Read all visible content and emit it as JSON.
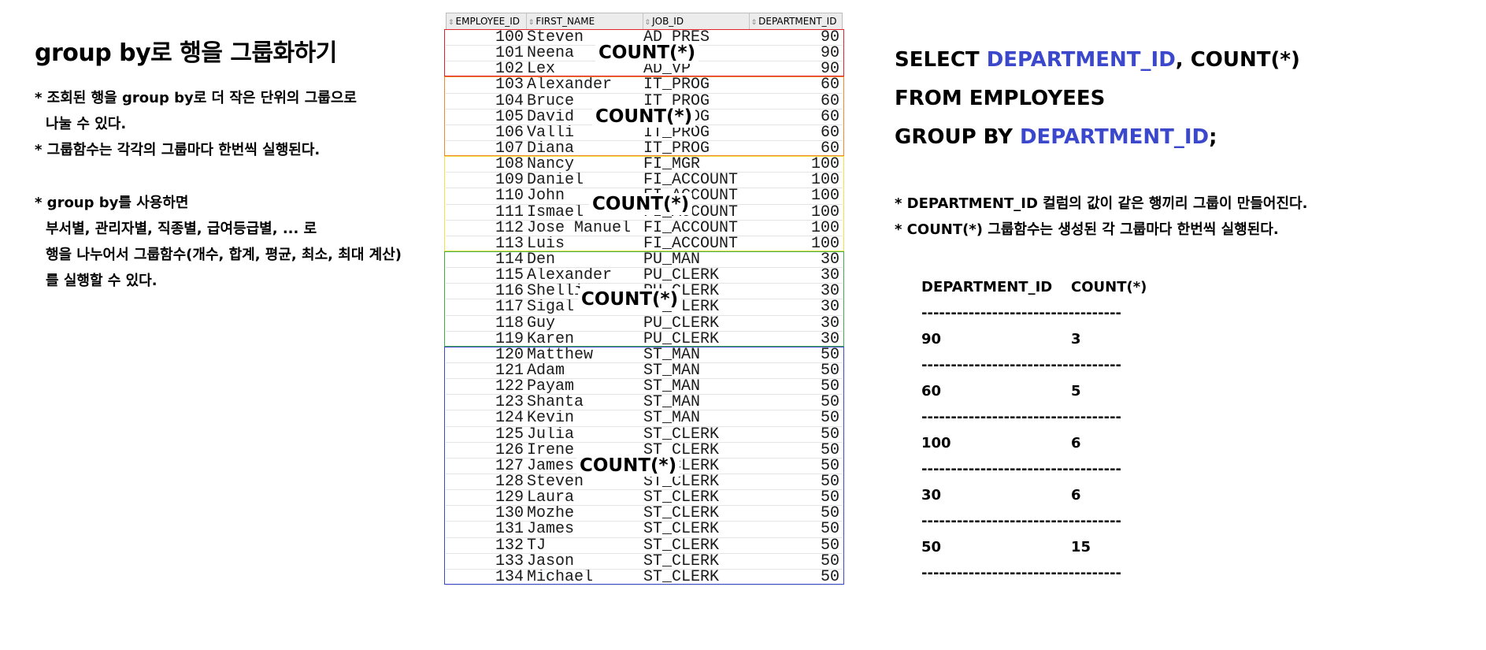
{
  "left": {
    "title": "group by로 행을 그룹화하기",
    "lines1": [
      "* 조회된 행을 group by로 더 작은 단위의 그룹으로",
      "  나눌 수 있다.",
      "* 그룹함수는 각각의 그룹마다 한번씩 실행된다."
    ],
    "lines2": [
      "* group by를 사용하면",
      "  부서별, 관리자별, 직종별, 급여등급별, ... 로",
      "  행을 나누어서 그룹함수(개수, 합계, 평균, 최소, 최대 계산)",
      "  를 실행할 수 있다."
    ]
  },
  "grid": {
    "columns": [
      "EMPLOYEE_ID",
      "FIRST_NAME",
      "JOB_ID",
      "DEPARTMENT_ID"
    ],
    "rows": [
      [
        "100",
        "Steven",
        "AD_PRES",
        "90"
      ],
      [
        "101",
        "Neena",
        "AD_VP",
        "90"
      ],
      [
        "102",
        "Lex",
        "AD_VP",
        "90"
      ],
      [
        "103",
        "Alexander",
        "IT_PROG",
        "60"
      ],
      [
        "104",
        "Bruce",
        "IT_PROG",
        "60"
      ],
      [
        "105",
        "David",
        "IT_PROG",
        "60"
      ],
      [
        "106",
        "Valli",
        "IT_PROG",
        "60"
      ],
      [
        "107",
        "Diana",
        "IT_PROG",
        "60"
      ],
      [
        "108",
        "Nancy",
        "FI_MGR",
        "100"
      ],
      [
        "109",
        "Daniel",
        "FI_ACCOUNT",
        "100"
      ],
      [
        "110",
        "John",
        "FI_ACCOUNT",
        "100"
      ],
      [
        "111",
        "Ismael",
        "FI_ACCOUNT",
        "100"
      ],
      [
        "112",
        "Jose Manuel",
        "FI_ACCOUNT",
        "100"
      ],
      [
        "113",
        "Luis",
        "FI_ACCOUNT",
        "100"
      ],
      [
        "114",
        "Den",
        "PU_MAN",
        "30"
      ],
      [
        "115",
        "Alexander",
        "PU_CLERK",
        "30"
      ],
      [
        "116",
        "Shelli",
        "PU_CLERK",
        "30"
      ],
      [
        "117",
        "Sigal",
        "PU_CLERK",
        "30"
      ],
      [
        "118",
        "Guy",
        "PU_CLERK",
        "30"
      ],
      [
        "119",
        "Karen",
        "PU_CLERK",
        "30"
      ],
      [
        "120",
        "Matthew",
        "ST_MAN",
        "50"
      ],
      [
        "121",
        "Adam",
        "ST_MAN",
        "50"
      ],
      [
        "122",
        "Payam",
        "ST_MAN",
        "50"
      ],
      [
        "123",
        "Shanta",
        "ST_MAN",
        "50"
      ],
      [
        "124",
        "Kevin",
        "ST_MAN",
        "50"
      ],
      [
        "125",
        "Julia",
        "ST_CLERK",
        "50"
      ],
      [
        "126",
        "Irene",
        "ST_CLERK",
        "50"
      ],
      [
        "127",
        "James",
        "ST_CLERK",
        "50"
      ],
      [
        "128",
        "Steven",
        "ST_CLERK",
        "50"
      ],
      [
        "129",
        "Laura",
        "ST_CLERK",
        "50"
      ],
      [
        "130",
        "Mozhe",
        "ST_CLERK",
        "50"
      ],
      [
        "131",
        "James",
        "ST_CLERK",
        "50"
      ],
      [
        "132",
        "TJ",
        "ST_CLERK",
        "50"
      ],
      [
        "133",
        "Jason",
        "ST_CLERK",
        "50"
      ],
      [
        "134",
        "Michael",
        "ST_CLERK",
        "50"
      ]
    ],
    "groups": [
      {
        "label": "COUNT(*)",
        "color": "#e0242c",
        "start": 0,
        "count": 3
      },
      {
        "label": "COUNT(*)",
        "color": "#f08a2c",
        "start": 3,
        "count": 5
      },
      {
        "label": "COUNT(*)",
        "color": "#f2e24a",
        "start": 8,
        "count": 6
      },
      {
        "label": "COUNT(*)",
        "color": "#3fae4a",
        "start": 14,
        "count": 6
      },
      {
        "label": "COUNT(*)",
        "color": "#3b48cc",
        "start": 20,
        "count": 15
      }
    ]
  },
  "sql": {
    "l1_kw": "SELECT ",
    "l1_col": "DEPARTMENT_ID",
    "l1_rest": ", COUNT(*)",
    "l2": "FROM EMPLOYEES",
    "l3_kw": "GROUP BY ",
    "l3_col": "DEPARTMENT_ID",
    "l3_end": ";"
  },
  "notes": [
    "* DEPARTMENT_ID 컬럼의 값이 같은 행끼리 그룹이 만들어진다.",
    "* COUNT(*) 그룹함수는 생성된 각 그룹마다 한번씩 실행된다."
  ],
  "result": {
    "h1": "DEPARTMENT_ID",
    "h2": "COUNT(*)",
    "dash": "----------------------------------",
    "rows": [
      [
        "90",
        "3"
      ],
      [
        "60",
        "5"
      ],
      [
        "100",
        "6"
      ],
      [
        "30",
        "6"
      ],
      [
        "50",
        "15"
      ]
    ]
  },
  "colors": {
    "keyword_blue": "#3b48cc"
  }
}
